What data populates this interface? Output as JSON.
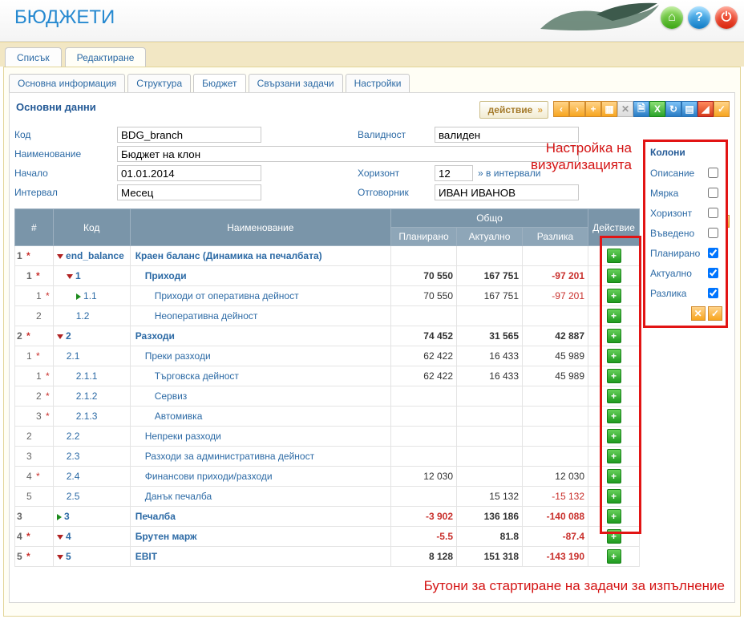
{
  "header": {
    "title": "БЮДЖЕТИ"
  },
  "top_tabs": [
    "Списък",
    "Редактиране"
  ],
  "top_tabs_active": 1,
  "sub_tabs": [
    "Основна информация",
    "Структура",
    "Бюджет",
    "Свързани задачи",
    "Настройки"
  ],
  "sub_tabs_active": 2,
  "section_title": "Основни данни",
  "action_button": "действие",
  "form": {
    "code_label": "Код",
    "code": "BDG_branch",
    "valid_label": "Валидност",
    "valid": "валиден",
    "name_label": "Наименование",
    "name": "Бюджет на клон",
    "start_label": "Начало",
    "start": "01.01.2014",
    "horizon_label": "Хоризонт",
    "horizon": "12",
    "horizon_note": "в интервали",
    "interval_label": "Интервал",
    "interval": "Месец",
    "owner_label": "Отговорник",
    "owner": "ИВАН ИВАНОВ"
  },
  "settings_label": "Настройки",
  "columns_panel": {
    "title": "Колони",
    "rows": [
      {
        "label": "Описание",
        "checked": false
      },
      {
        "label": "Мярка",
        "checked": false
      },
      {
        "label": "Хоризонт",
        "checked": false
      },
      {
        "label": "Въведено",
        "checked": false
      },
      {
        "label": "Планирано",
        "checked": true
      },
      {
        "label": "Актуално",
        "checked": true
      },
      {
        "label": "Разлика",
        "checked": true
      }
    ]
  },
  "annotation_top": "Настройка на\nвизуализацията",
  "annotation_bottom": "Бутони за стартиране на задачи за изпълнение",
  "table": {
    "headers": {
      "idx": "#",
      "code": "Код",
      "name": "Наименование",
      "total": "Общо",
      "plan": "Планирано",
      "actual": "Актуално",
      "diff": "Разлика",
      "act": "Действие"
    },
    "rows": [
      {
        "lvl": 0,
        "i": "1",
        "star": true,
        "m": "down",
        "code": "end_balance",
        "name": "Краен баланс (Динамика на печалбата)",
        "bold": true
      },
      {
        "lvl": 1,
        "i": "1",
        "star": true,
        "m": "down",
        "code": "1",
        "name": "Приходи",
        "plan": "70 550",
        "act": "167 751",
        "diff": "-97 201",
        "neg": true,
        "bold": true
      },
      {
        "lvl": 2,
        "i": "1",
        "star": true,
        "m": "side",
        "code": "1.1",
        "name": "Приходи от оперативна дейност",
        "plan": "70 550",
        "act": "167 751",
        "diff": "-97 201",
        "neg": true
      },
      {
        "lvl": 2,
        "i": "2",
        "code": "1.2",
        "name": "Неоперативна дейност"
      },
      {
        "lvl": 0,
        "i": "2",
        "star": true,
        "m": "down",
        "code": "2",
        "name": "Разходи",
        "plan": "74 452",
        "act": "31 565",
        "diff": "42 887",
        "bold": true
      },
      {
        "lvl": 1,
        "i": "1",
        "star": true,
        "code": "2.1",
        "name": "Преки разходи",
        "plan": "62 422",
        "act": "16 433",
        "diff": "45 989"
      },
      {
        "lvl": 2,
        "i": "1",
        "star": true,
        "code": "2.1.1",
        "name": "Търговска дейност",
        "plan": "62 422",
        "act": "16 433",
        "diff": "45 989"
      },
      {
        "lvl": 2,
        "i": "2",
        "star": true,
        "code": "2.1.2",
        "name": "Сервиз"
      },
      {
        "lvl": 2,
        "i": "3",
        "star": true,
        "code": "2.1.3",
        "name": "Автомивка"
      },
      {
        "lvl": 1,
        "i": "2",
        "code": "2.2",
        "name": "Непреки разходи"
      },
      {
        "lvl": 1,
        "i": "3",
        "code": "2.3",
        "name": "Разходи за административна дейност"
      },
      {
        "lvl": 1,
        "i": "4",
        "star": true,
        "code": "2.4",
        "name": "Финансови приходи/разходи",
        "plan": "12 030",
        "diff": "12 030"
      },
      {
        "lvl": 1,
        "i": "5",
        "code": "2.5",
        "name": "Данък печалба",
        "act": "15 132",
        "diff": "-15 132",
        "neg": true
      },
      {
        "lvl": 0,
        "i": "3",
        "m": "side",
        "code": "3",
        "name": "Печалба",
        "plan": "-3 902",
        "planneg": true,
        "act": "136 186",
        "diff": "-140 088",
        "neg": true,
        "bold": true
      },
      {
        "lvl": 0,
        "i": "4",
        "star": true,
        "m": "down",
        "code": "4",
        "name": "Брутен марж",
        "plan": "-5.5",
        "planneg": true,
        "act": "81.8",
        "diff": "-87.4",
        "neg": true,
        "bold": true
      },
      {
        "lvl": 0,
        "i": "5",
        "star": true,
        "m": "down",
        "code": "5",
        "name": "EBIT",
        "plan": "8 128",
        "act": "151 318",
        "diff": "-143 190",
        "neg": true,
        "bold": true
      }
    ]
  }
}
